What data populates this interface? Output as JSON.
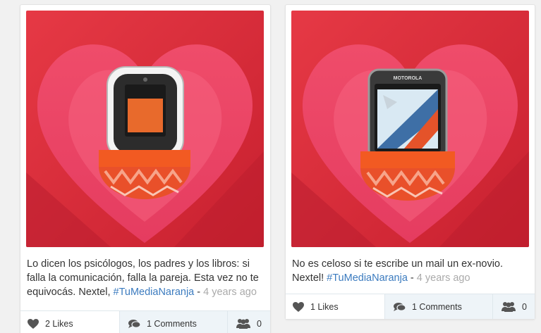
{
  "posts": [
    {
      "caption": "Lo dicen los psicólogos, los padres y los libros: si falla la comunicación, falla la pareja. Esta vez no te equivocás. Nextel,",
      "hashtag": "#TuMediaNaranja",
      "separator": " - ",
      "time": "4 years ago",
      "likes": "2 Likes",
      "comments": "1 Comments",
      "groups": "0",
      "phone_brand": ""
    },
    {
      "caption": "No es celoso si te escribe un mail un ex-novio. Nextel!",
      "hashtag": "#TuMediaNaranja",
      "separator": " - ",
      "time": "4 years ago",
      "likes": "1 Likes",
      "comments": "1 Comments",
      "groups": "0",
      "phone_brand": "MOTOROLA"
    }
  ],
  "colors": {
    "background_red": "#d92e3b",
    "heart_pink": "#ee4869",
    "sock_orange": "#f25a22",
    "hashtag_blue": "#3b7bbf",
    "icon_gray": "#555555"
  },
  "icons": [
    "heart-icon",
    "comment-icon",
    "group-icon"
  ]
}
